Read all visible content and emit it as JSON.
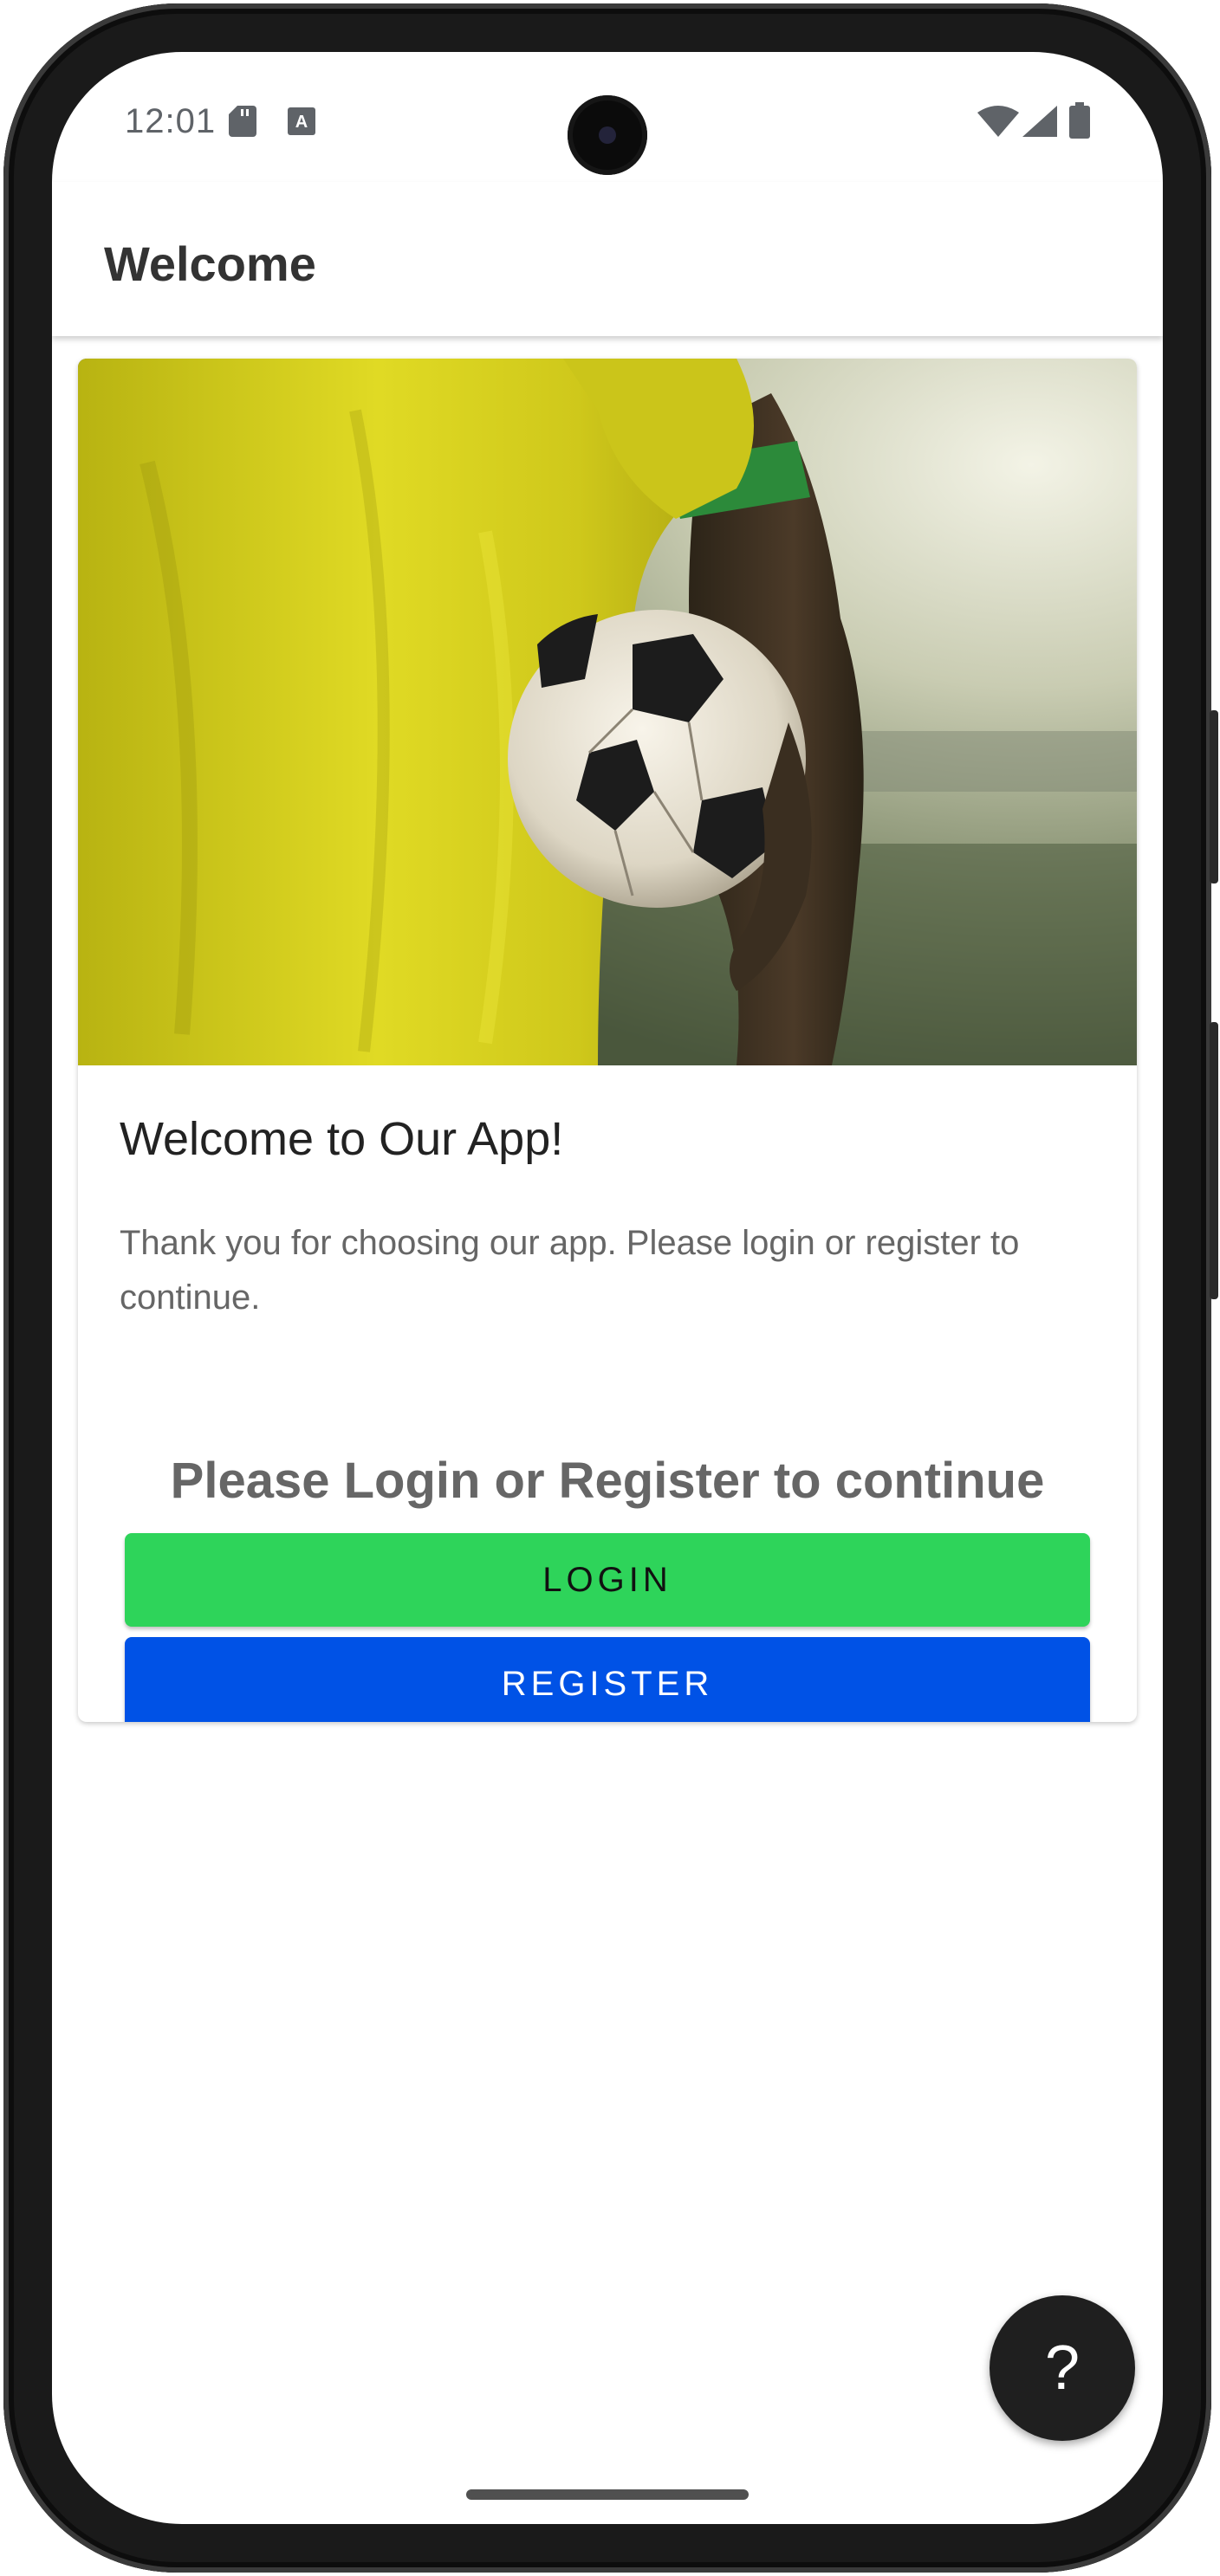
{
  "status_bar": {
    "time": "12:01",
    "icons": [
      "sd-card-icon",
      "keyboard-a-icon",
      "wifi-icon",
      "signal-icon",
      "battery-icon"
    ]
  },
  "app_bar": {
    "title": "Welcome"
  },
  "card": {
    "image_alt": "Soccer player in yellow shirt holding a ball",
    "title": "Welcome to Our App!",
    "body": "Thank you for choosing our app. Please login or register to continue.",
    "prompt": "Please Login or Register to continue",
    "login_label": "LOGIN",
    "register_label": "REGISTER"
  },
  "fab": {
    "label": "?"
  },
  "colors": {
    "login_button": "#2ed45a",
    "register_button": "#0052e6",
    "fab": "#1f1f1f",
    "shirt": "#d6d21e",
    "armband": "#2c8a3a"
  }
}
